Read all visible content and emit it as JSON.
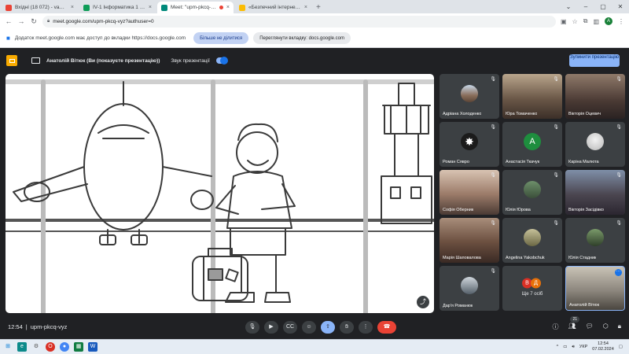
{
  "browser": {
    "tabs": [
      {
        "title": "Вхідні (18 072) - vam@vtep.vn...",
        "color": "#ea4335",
        "active": false
      },
      {
        "title": "IV-1 Інформатика 1 курс",
        "color": "#0f9d58",
        "active": false
      },
      {
        "title": "Meet: \"upm-pkcq-vyz\"",
        "color": "#00897b",
        "active": true
      },
      {
        "title": "«Безпечний інтернет та с...",
        "color": "#fbbc04",
        "active": false
      }
    ],
    "new_tab": "+",
    "url": "meet.google.com/upm-pkcq-vyz?authuser=0",
    "account_initial": "А"
  },
  "share_bar": {
    "message": "Додаток meet.google.com має доступ до вкладки https://docs.google.com",
    "stop_label": "Більше не ділитися",
    "switch_label": "Переглянути вкладку: docs.google.com"
  },
  "meet_header": {
    "presenter": "Анатолій Вітюк (Ви (показуєте презентацію))",
    "audio_label": "Звук презентації",
    "stop_button": "Зупинити презентацію"
  },
  "participants": [
    {
      "name": "Адріана Холоденко",
      "avatar": "photo"
    },
    {
      "name": "Юра Томаченко",
      "avatar": "video"
    },
    {
      "name": "Вікторія Оцевич",
      "avatar": "video"
    },
    {
      "name": "Роман Сявро",
      "avatar": "icon",
      "glyph": "✸"
    },
    {
      "name": "Анастасія Ткачук",
      "avatar": "letter",
      "letter": "А"
    },
    {
      "name": "Каріна Малюта",
      "avatar": "photo2"
    },
    {
      "name": "Софія Оберник",
      "avatar": "video"
    },
    {
      "name": "Юлія Юрова",
      "avatar": "photo"
    },
    {
      "name": "Вікторія Засідівко",
      "avatar": "video"
    },
    {
      "name": "Марія Шаповалова",
      "avatar": "video"
    },
    {
      "name": "Angelina Yakobchuk",
      "avatar": "photo"
    },
    {
      "name": "Юлія Стадник",
      "avatar": "photo"
    },
    {
      "name": "Дар'я Романюк",
      "avatar": "photo"
    },
    {
      "name": "Ще 7 осіб",
      "avatar": "more",
      "letters": [
        "В",
        "Д"
      ]
    },
    {
      "name": "Анатолій Вітюк",
      "avatar": "video"
    }
  ],
  "controls": {
    "time": "12:54",
    "separator": "|",
    "meeting_code": "upm-pkcq-vyz",
    "participant_count": "21"
  },
  "taskbar": {
    "language": "УКР",
    "time": "12:54",
    "date": "07.02.2024"
  },
  "colors": {
    "meet_bg": "#202124",
    "accent": "#8ab4f8",
    "end_call": "#ea4335"
  }
}
